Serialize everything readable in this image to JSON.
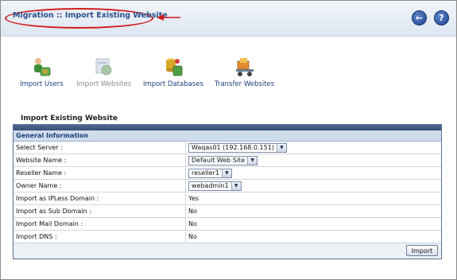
{
  "header": {
    "title": "Migration :: Import Existing Website",
    "back_icon": "back-arrow-icon",
    "help_icon": "help-icon"
  },
  "toolbar": {
    "items": [
      {
        "label": "Import Users",
        "icon": "import-users-icon",
        "enabled": true
      },
      {
        "label": "Import Websites",
        "icon": "import-websites-icon",
        "enabled": false
      },
      {
        "label": "Import Databases",
        "icon": "import-databases-icon",
        "enabled": true
      },
      {
        "label": "Transfer Websites",
        "icon": "transfer-websites-icon",
        "enabled": true
      }
    ]
  },
  "section": {
    "title": "Import Existing Website",
    "panel_header": "General Information"
  },
  "form": {
    "rows": [
      {
        "label": "Select Server :",
        "value": "Waqas01 (192.168.0.151)"
      },
      {
        "label": "Website Name :",
        "value": "Default Web Site"
      },
      {
        "label": "Reseller Name :",
        "value": "reseller1"
      },
      {
        "label": "Owner Name :",
        "value": "webadmin1"
      },
      {
        "label": "Import as IPLess Domain :",
        "value": "Yes"
      },
      {
        "label": "Import as Sub Domain :",
        "value": "No"
      },
      {
        "label": "Import Mail Domain :",
        "value": "No"
      },
      {
        "label": "Import DNS :",
        "value": "No"
      }
    ]
  },
  "buttons": {
    "import_label": "Import"
  },
  "colors": {
    "accent": "#2a4f8a",
    "annotation": "#d11c1c",
    "panel_bar": "#4e6892"
  }
}
